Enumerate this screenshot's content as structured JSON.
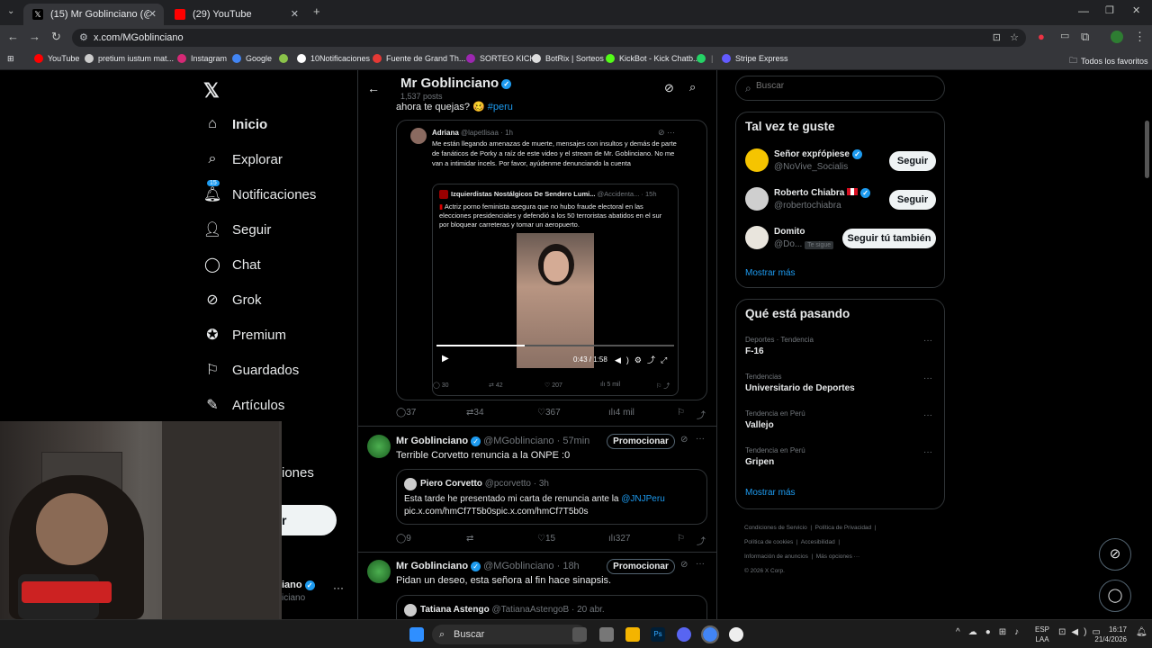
{
  "browser": {
    "tabs": [
      {
        "title": "(15) Mr Goblinciano (@MGoblinciano)",
        "active": true
      },
      {
        "title": "(29) YouTube",
        "active": false
      }
    ],
    "url": "x.com/MGoblinciano",
    "bookmarks": [
      "YouTube",
      "pretium iustum mat...",
      "Instagram",
      "Google",
      "10Notificaciones",
      "Fuente de Grand Th...",
      "SORTEO KICK",
      "BotRix | Sorteos",
      "KickBot - Kick Chatb...",
      "Stripe Express"
    ],
    "all_favorites": "Todos los favoritos"
  },
  "sidebar": {
    "badge": "15",
    "items": [
      "Inicio",
      "Explorar",
      "Notificaciones",
      "Seguir",
      "Chat",
      "Grok",
      "Premium",
      "Guardados",
      "Artículos",
      "iones"
    ],
    "account_name_partial": "iano",
    "account_handle_partial": "iciano",
    "post_btn_partial": "r"
  },
  "profile": {
    "name": "Mr Goblinciano",
    "posts": "1,537 posts"
  },
  "tweet1": {
    "text": "ahora te quejas? 🥴",
    "hashtag": "#peru",
    "quote": {
      "author": "Adriana",
      "handle": "@lapetlisaa · 1h",
      "text": "Me están llegando amenazas de muerte, mensajes con insultos y demás de parte de fanáticos de Porky a raíz de este video y el stream de Mr. Goblinciano. No me van a intimidar incels. Por favor, ayúdenme denunciando la cuenta",
      "inner": {
        "author": "Izquierdistas Nostálgicos De Sendero Lumi...",
        "handle": "@Accidenta... · 15h",
        "text": "Actriz porno feminista asegura que no hubo fraude electoral en las elecciones presidenciales y defendió a los 50 terroristas abatidos en el sur por bloquear carreteras y tomar un aeropuerto."
      },
      "video_time": "0:43 / 1:58",
      "stats": [
        "30",
        "42",
        "207",
        "5 mil"
      ]
    },
    "stats": {
      "replies": "37",
      "reposts": "34",
      "likes": "367",
      "views": "4 mil"
    }
  },
  "tweet2": {
    "name": "Mr Goblinciano",
    "handle": "@MGoblinciano · 57min",
    "promote": "Promocionar",
    "text": "Terrible Corvetto renuncia a la ONPE :0",
    "quote": {
      "author": "Piero Corvetto",
      "handle": "@pcorvetto · 3h",
      "text": "Esta tarde he presentado mi carta de renuncia ante la",
      "mention": "@JNJPeru",
      "link": "pic.x.com/hmCf7T5b0spic.x.com/hmCf7T5b0s"
    },
    "stats": {
      "replies": "9",
      "reposts": "",
      "likes": "15",
      "views": "327"
    }
  },
  "tweet3": {
    "name": "Mr Goblinciano",
    "handle": "@MGoblinciano · 18h",
    "promote": "Promocionar",
    "text": "Pidan un deseo, esta señora al fin hace sinapsis.",
    "quote": {
      "author": "Tatiana Astengo",
      "handle": "@TatianaAstengoB · 20 abr."
    }
  },
  "right": {
    "search_placeholder": "Buscar",
    "who_title": "Tal vez te guste",
    "who": [
      {
        "name": "Señor expŕópiese",
        "handle": "@NoVive_Socialis",
        "btn": "Seguir"
      },
      {
        "name": "Roberto Chiabra",
        "handle": "@robertochiabra",
        "btn": "Seguir"
      },
      {
        "name": "Domito",
        "handle": "@Do...",
        "btn": "Seguir tú también",
        "tag": "Te sigue"
      }
    ],
    "show_more": "Mostrar más",
    "trends_title": "Qué está pasando",
    "trends": [
      {
        "meta": "Deportes · Tendencia",
        "name": "F-16"
      },
      {
        "meta": "Tendencias",
        "name": "Universitario de Deportes"
      },
      {
        "meta": "Tendencia en Perú",
        "name": "Vallejo"
      },
      {
        "meta": "Tendencia en Perú",
        "name": "Gripen"
      }
    ],
    "show_more2": "Mostrar más",
    "footer": [
      "Condiciones de Servicio",
      "Política de Privacidad",
      "Política de cookies",
      "Accesibilidad",
      "Información de anuncios",
      "Más opciones ···",
      "© 2026 X Corp."
    ]
  },
  "taskbar": {
    "search": "Buscar",
    "lang": "ESP",
    "lang2": "LAA",
    "time": "16:17",
    "date": "21/4/2026"
  }
}
